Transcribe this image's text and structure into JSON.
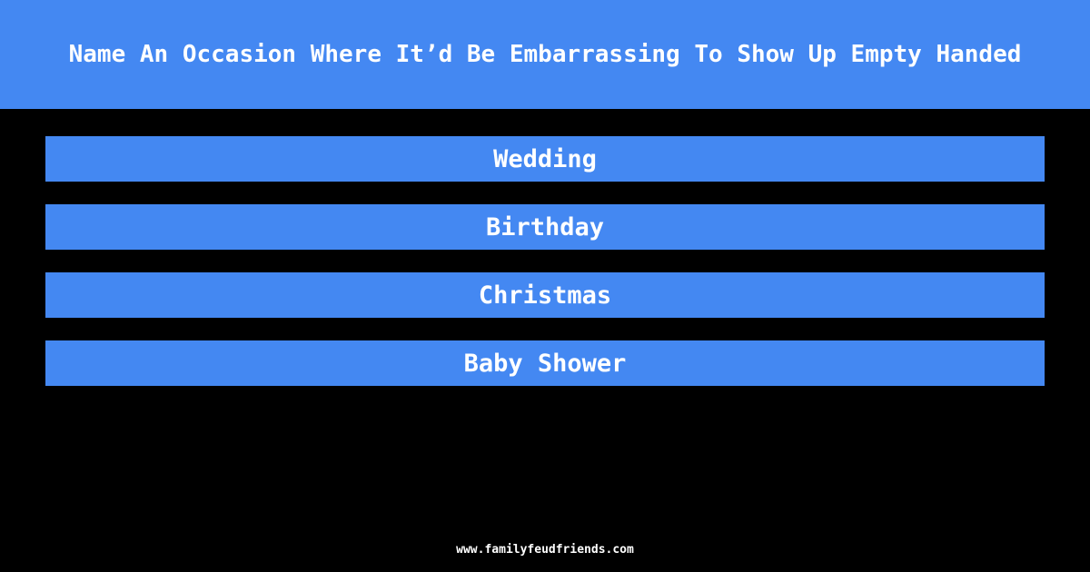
{
  "question": "Name An Occasion Where It’d Be Embarrassing To Show Up Empty Handed",
  "answers": [
    "Wedding",
    "Birthday",
    "Christmas",
    "Baby Shower"
  ],
  "footer": "www.familyfeudfriends.com",
  "colors": {
    "accent": "#4488f2",
    "background": "#000000",
    "text": "#ffffff"
  }
}
